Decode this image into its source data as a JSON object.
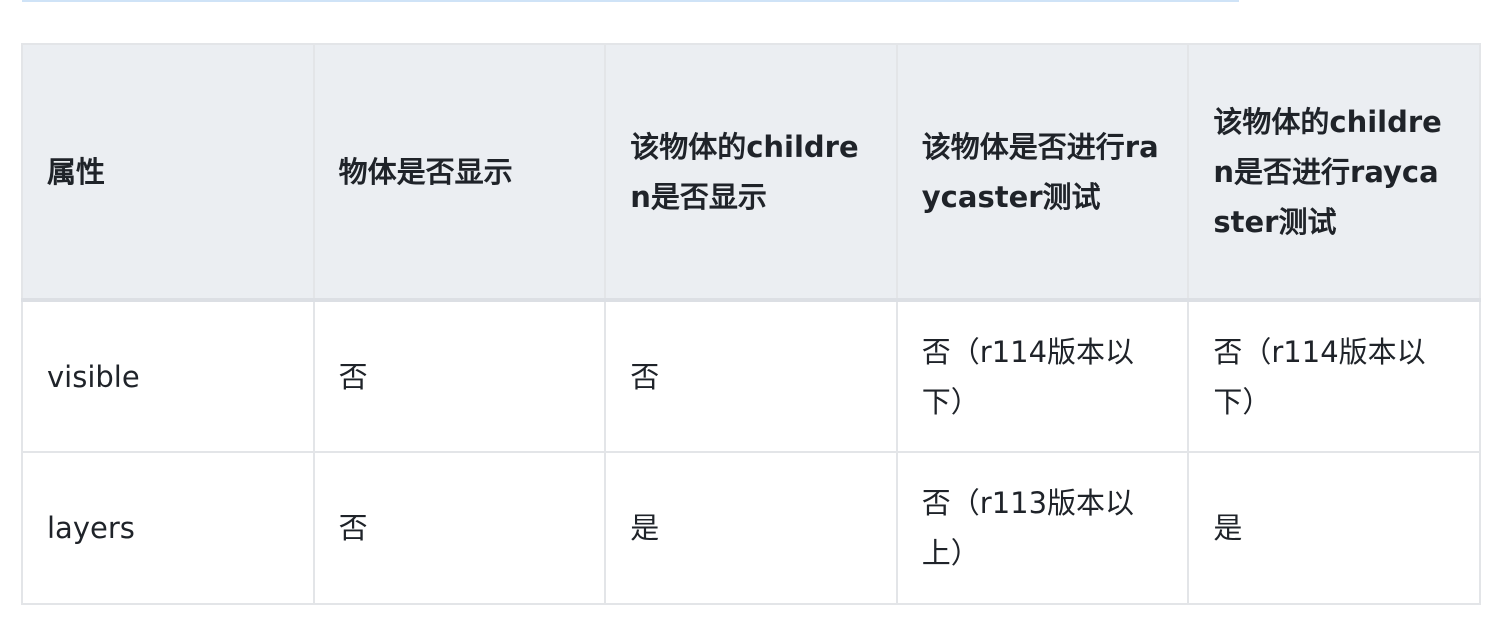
{
  "table": {
    "headers": [
      "属性",
      "物体是否显示",
      "该物体的children是否显示",
      "该物体是否进行raycaster测试",
      "该物体的children是否进行raycaster测试"
    ],
    "rows": [
      [
        "visible",
        "否",
        "否",
        "否（r114版本以下）",
        "否（r114版本以下）"
      ],
      [
        "layers",
        "否",
        "是",
        "否（r113版本以上）",
        "是"
      ]
    ]
  }
}
